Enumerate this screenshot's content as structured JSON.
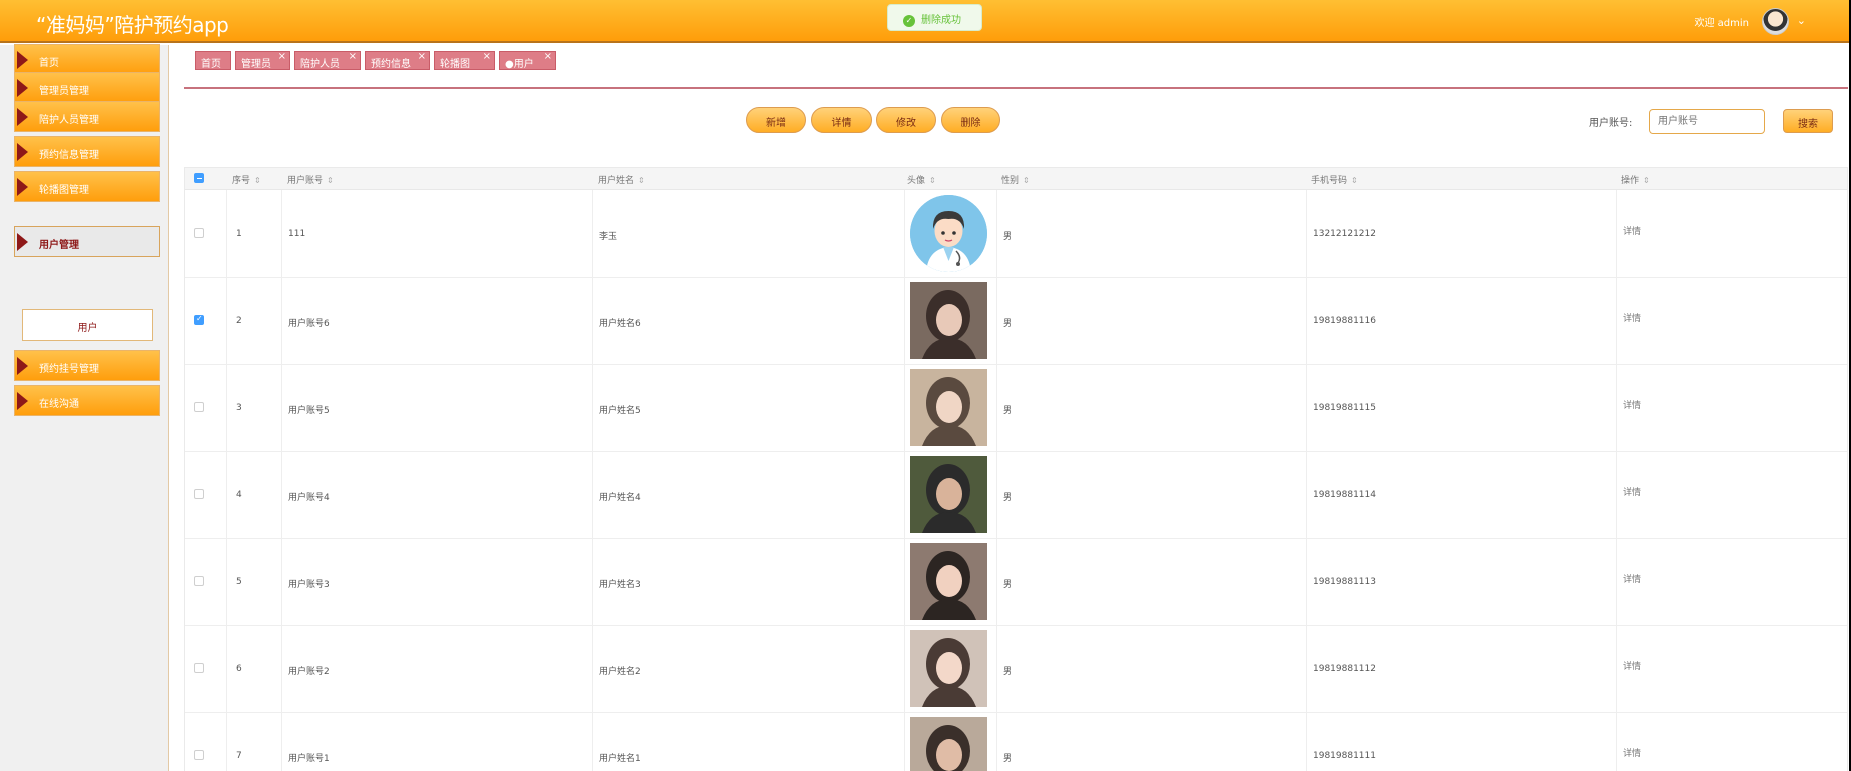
{
  "header": {
    "title": "“准妈妈”陪护预约app",
    "toast": "删除成功",
    "welcome": "欢迎 admin",
    "caret": "⌄"
  },
  "sidebar": {
    "items": [
      {
        "label": "首页"
      },
      {
        "label": "管理员管理"
      },
      {
        "label": "陪护人员管理"
      },
      {
        "label": "预约信息管理"
      },
      {
        "label": "轮播图管理"
      },
      {
        "label": "用户管理"
      },
      {
        "label": "预约挂号管理"
      },
      {
        "label": "在线沟通"
      }
    ],
    "active_index": 5,
    "submenu": {
      "label": "用户"
    }
  },
  "tabs": [
    {
      "label": "首页",
      "closable": false
    },
    {
      "label": "管理员",
      "closable": true
    },
    {
      "label": "陪护人员",
      "closable": true
    },
    {
      "label": "预约信息",
      "closable": true
    },
    {
      "label": "轮播图",
      "closable": true
    },
    {
      "label": "●用户",
      "closable": true
    }
  ],
  "actions": {
    "add": "新增",
    "detail": "详情",
    "edit": "修改",
    "delete": "删除"
  },
  "search": {
    "label": "用户账号:",
    "placeholder": "用户账号",
    "button": "搜索"
  },
  "table": {
    "columns": [
      "序号",
      "用户账号",
      "用户姓名",
      "头像",
      "性别",
      "手机号码",
      "操作"
    ],
    "sort_glyph": "⇕",
    "rows": [
      {
        "index": "1",
        "account": "111",
        "name": "李玉",
        "gender": "男",
        "phone": "13212121212",
        "op": "详情",
        "checked": false,
        "avatar": "cartoon-doctor"
      },
      {
        "index": "2",
        "account": "用户账号6",
        "name": "用户姓名6",
        "gender": "男",
        "phone": "19819881116",
        "op": "详情",
        "checked": true,
        "avatar": "photo"
      },
      {
        "index": "3",
        "account": "用户账号5",
        "name": "用户姓名5",
        "gender": "男",
        "phone": "19819881115",
        "op": "详情",
        "checked": false,
        "avatar": "photo"
      },
      {
        "index": "4",
        "account": "用户账号4",
        "name": "用户姓名4",
        "gender": "男",
        "phone": "19819881114",
        "op": "详情",
        "checked": false,
        "avatar": "photo"
      },
      {
        "index": "5",
        "account": "用户账号3",
        "name": "用户姓名3",
        "gender": "男",
        "phone": "19819881113",
        "op": "详情",
        "checked": false,
        "avatar": "photo"
      },
      {
        "index": "6",
        "account": "用户账号2",
        "name": "用户姓名2",
        "gender": "男",
        "phone": "19819881112",
        "op": "详情",
        "checked": false,
        "avatar": "photo"
      },
      {
        "index": "7",
        "account": "用户账号1",
        "name": "用户姓名1",
        "gender": "男",
        "phone": "19819881111",
        "op": "详情",
        "checked": false,
        "avatar": "photo"
      }
    ]
  },
  "colors": {
    "header": "#ff9d0a",
    "menu_accent": "#8e1818",
    "tab": "#de7d87",
    "checkbox": "#409eff"
  }
}
